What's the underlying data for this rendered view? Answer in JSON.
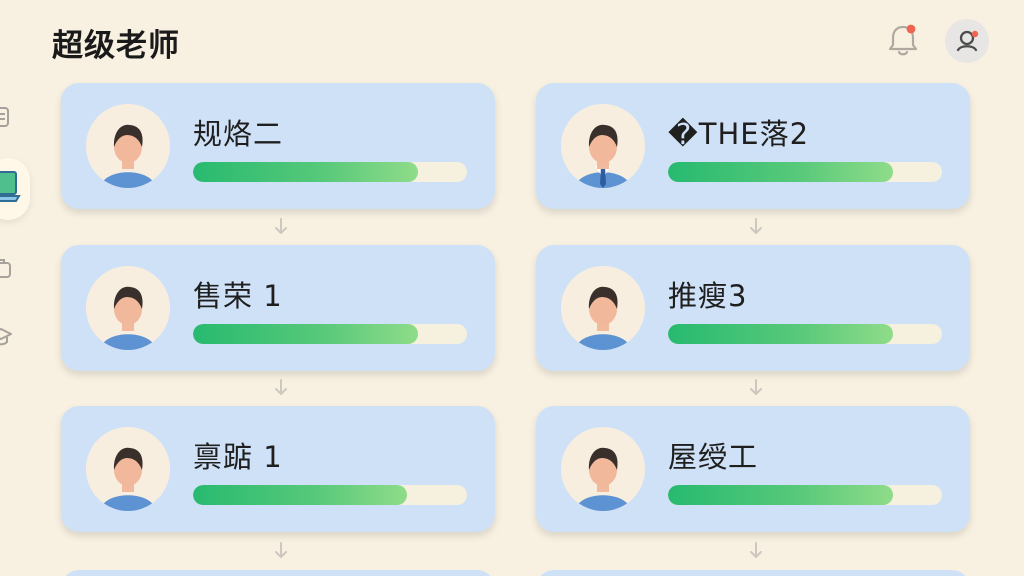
{
  "header": {
    "title": "超级老师"
  },
  "colors": {
    "background": "#f8f1e2",
    "card": "#cfe1f7",
    "progress_start": "#27ba70",
    "progress_end": "#8fdc89",
    "track": "#f6f0df",
    "notification_dot": "#ef6450"
  },
  "icons": {
    "notification": "bell-icon",
    "profile": "profile-icon",
    "sidebar": [
      "document-icon",
      "laptop-icon",
      "briefcase-icon",
      "graduation-cap-icon"
    ]
  },
  "cards": [
    {
      "name": "规烙二",
      "progress": 0.82,
      "avatar": "student"
    },
    {
      "name": "�THE落2",
      "progress": 0.82,
      "avatar": "suit"
    },
    {
      "name": "售荣 1",
      "progress": 0.82,
      "avatar": "student"
    },
    {
      "name": "推瘦3",
      "progress": 0.82,
      "avatar": "student"
    },
    {
      "name": "禀踮 1",
      "progress": 0.78,
      "avatar": "student"
    },
    {
      "name": "屋绶工",
      "progress": 0.82,
      "avatar": "student"
    }
  ]
}
